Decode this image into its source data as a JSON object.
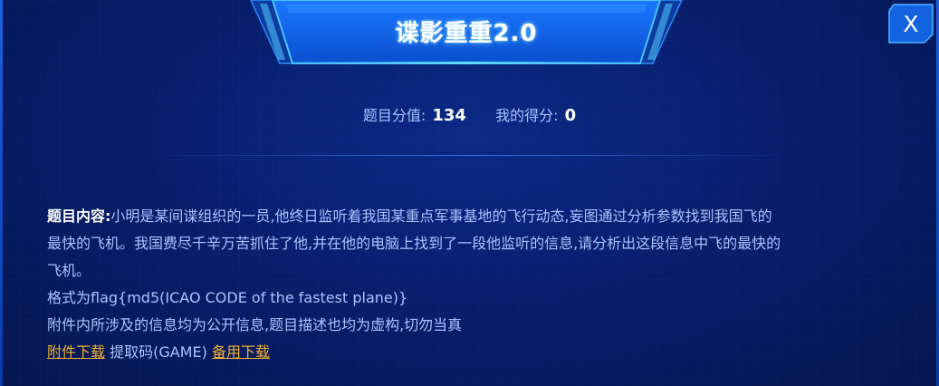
{
  "dialog": {
    "title": "谍影重重2.0",
    "close_label": "X"
  },
  "score": {
    "points_label": "题目分值:",
    "points_value": "134",
    "my_score_label": "我的得分:",
    "my_score_value": "0"
  },
  "content": {
    "label": "题目内容:",
    "description_line1": "小明是某间谍组织的一员,他终日监听着我国某重点军事基地的飞行动态,妄图通过分析参数找到我国飞的",
    "description_line2": "最快的飞机。我国费尽千辛万苦抓住了他,并在他的电脑上找到了一段他监听的信息,请分析出这段信息中飞的最快的",
    "description_line3": "飞机。",
    "format_line": "格式为flag{md5(ICAO CODE of the fastest plane)}",
    "notice_line": "附件内所涉及的信息均为公开信息,题目描述也均为虚构,切勿当真",
    "download_link": "附件下载",
    "extract_code": "提取码(GAME)",
    "backup_link": "备用下载"
  },
  "colors": {
    "background": "#061a5e",
    "text": "#a9c3ff",
    "link": "#f0b230",
    "banner": "#1565e6"
  }
}
